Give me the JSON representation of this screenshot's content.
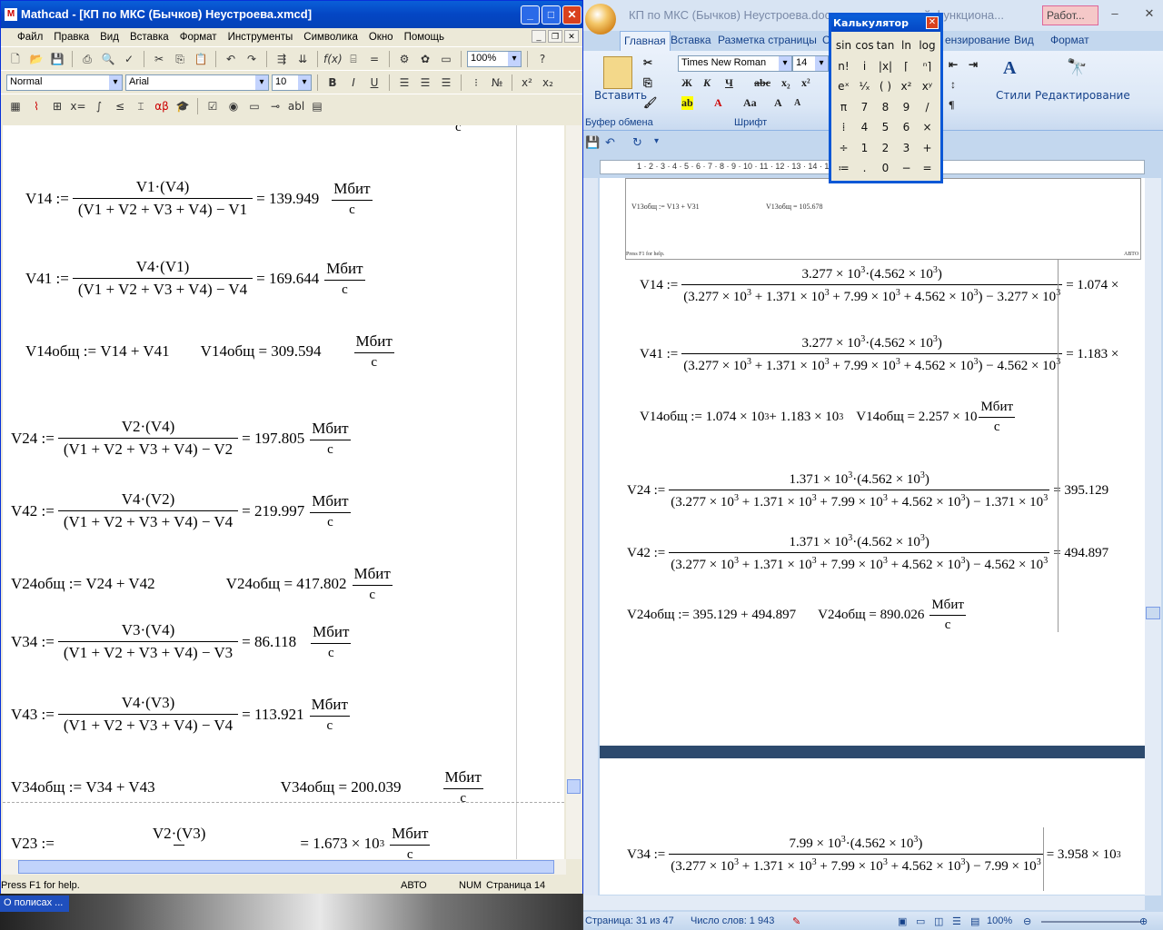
{
  "desktop": {
    "taskbar_item": "О полисах ..."
  },
  "mathcad": {
    "title": "Mathcad - [КП по МКС (Бычков) Неустроева.xmcd]",
    "menu": [
      "Файл",
      "Правка",
      "Вид",
      "Вставка",
      "Формат",
      "Инструменты",
      "Символика",
      "Окно",
      "Помощь"
    ],
    "zoom": "100%",
    "style": "Normal",
    "font": "Arial",
    "font_size": "10",
    "status": {
      "help": "Press F1 for help.",
      "mode": "АВТО",
      "num": "NUM",
      "page": "Страница 14"
    },
    "unit": {
      "top": "Мбит",
      "bottom": "с"
    },
    "equations": [
      {
        "lhs": "V14 :=",
        "num": "V1·(V4)",
        "den": "(V1 + V2 + V3 + V4) − V1",
        "result": "= 139.949"
      },
      {
        "lhs": "V41 :=",
        "num": "V4·(V1)",
        "den": "(V1 + V2 + V3 + V4) − V4",
        "result": "= 169.644"
      },
      {
        "def": "V14общ := V14 + V41",
        "res": "V14общ = 309.594"
      },
      {
        "lhs": "V24 :=",
        "num": "V2·(V4)",
        "den": "(V1 + V2 + V3 + V4) − V2",
        "result": "= 197.805"
      },
      {
        "lhs": "V42 :=",
        "num": "V4·(V2)",
        "den": "(V1 + V2 + V3 + V4) − V4",
        "result": "= 219.997"
      },
      {
        "def": "V24общ := V24 + V42",
        "res": "V24общ = 417.802"
      },
      {
        "lhs": "V34 :=",
        "num": "V3·(V4)",
        "den": "(V1 + V2 + V3 + V4) − V3",
        "result": "= 86.118"
      },
      {
        "lhs": "V43 :=",
        "num": "V4·(V3)",
        "den": "(V1 + V2 + V3 + V4) − V4",
        "result": "= 113.921"
      },
      {
        "def": "V34общ := V34 + V43",
        "res": "V34общ = 200.039"
      },
      {
        "lhs": "V23 :=",
        "num": "V2·(V3)",
        "den": "",
        "result": "= 1.673 × 10",
        "exp": "3"
      }
    ]
  },
  "word": {
    "title": "КП по МКС (Бычков) Неустроева.docx",
    "title_suffix": "й функциона...",
    "context_tab": "Работ...",
    "tabs": [
      "Главная",
      "Вставка",
      "Разметка страницы",
      "С",
      "ензирование",
      "Вид",
      "Формат"
    ],
    "font": "Times New Roman",
    "font_size": "14",
    "groups": {
      "clipboard": "Буфер обмена",
      "font": "Шрифт",
      "styles": "Стили",
      "editing": "Редактирование",
      "paste": "Вставить"
    },
    "inner_shot": {
      "def": "V13общ := V13 + V31",
      "res": "V13общ = 105.678",
      "help": "Press F1 for help.",
      "mode": "АВТО"
    },
    "sum_parts": [
      "3.277 × 10",
      "1.371 × 10",
      "7.99 × 10",
      "4.562 × 10"
    ],
    "eq": [
      {
        "lhs": "V14 :=",
        "num_a": "3.277 × 10",
        "num_b": "4.562 × 10",
        "sub": "3.277 × 10",
        "result": "= 1.074 ×"
      },
      {
        "lhs": "V41 :=",
        "num_a": "3.277 × 10",
        "num_b": "4.562 × 10",
        "sub": "4.562 × 10",
        "result": "= 1.183 ×"
      },
      {
        "def": "V14общ := 1.074 × 10",
        "def_b": " + 1.183 × 10",
        "res": "V14общ = 2.257 × 10"
      },
      {
        "lhs": "V24 :=",
        "num_a": "1.371 × 10",
        "num_b": "4.562 × 10",
        "sub": "1.371 × 10",
        "result": "= 395.129"
      },
      {
        "lhs": "V42 :=",
        "num_a": "1.371 × 10",
        "num_b": "4.562 × 10",
        "sub": "4.562 × 10",
        "result": "= 494.897"
      },
      {
        "def": "V24общ := 395.129 + 494.897",
        "res": "V24общ = 890.026"
      },
      {
        "lhs": "V34 :=",
        "num_a": "7.99 × 10",
        "num_b": "4.562 × 10",
        "sub": "7.99 × 10",
        "result": "= 3.958 × 10"
      }
    ],
    "exp": "3",
    "status": {
      "page": "Страница: 31 из 47",
      "words": "Число слов: 1 943",
      "zoom": "100%"
    }
  },
  "calculator": {
    "title": "Калькулятор",
    "keys": [
      "sin",
      "cos",
      "tan",
      "ln",
      "log",
      "n!",
      "i",
      "|x|",
      "⌈",
      "ⁿ⌉",
      "eˣ",
      "¹⁄ₓ",
      "( )",
      "x²",
      "xʸ",
      "π",
      "7",
      "8",
      "9",
      "/",
      "⁞",
      "4",
      "5",
      "6",
      "×",
      "÷",
      "1",
      "2",
      "3",
      "+",
      "≔",
      ".",
      "0",
      "−",
      "="
    ]
  }
}
